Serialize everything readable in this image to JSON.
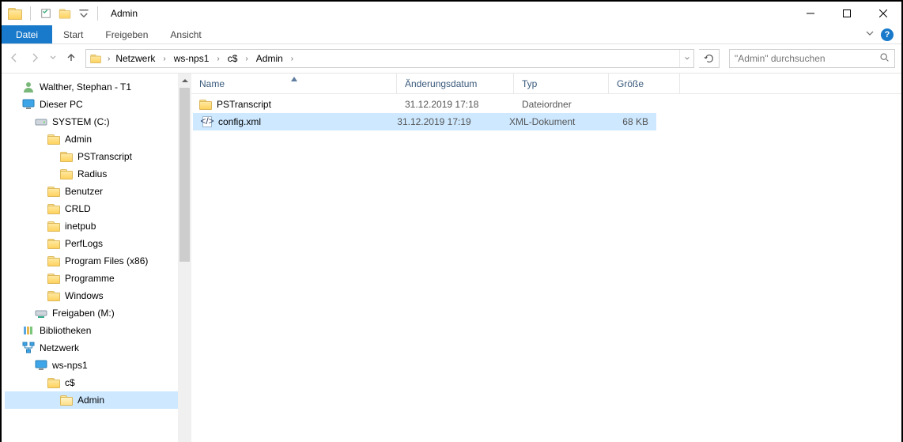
{
  "window": {
    "title": "Admin"
  },
  "ribbon": {
    "file": "Datei",
    "tabs": [
      "Start",
      "Freigeben",
      "Ansicht"
    ]
  },
  "breadcrumb": [
    "Netzwerk",
    "ws-nps1",
    "c$",
    "Admin"
  ],
  "search": {
    "placeholder": "\"Admin\" durchsuchen"
  },
  "columns": {
    "name": "Name",
    "date": "Änderungsdatum",
    "type": "Typ",
    "size": "Größe"
  },
  "files": [
    {
      "name": "PSTranscript",
      "date": "31.12.2019 17:18",
      "type": "Dateiordner",
      "size": "",
      "icon": "folder",
      "selected": false
    },
    {
      "name": "config.xml",
      "date": "31.12.2019 17:19",
      "type": "XML-Dokument",
      "size": "68 KB",
      "icon": "xml",
      "selected": true
    }
  ],
  "tree": [
    {
      "label": "Walther, Stephan - T1",
      "icon": "user",
      "indent": 0,
      "selected": false
    },
    {
      "label": "Dieser PC",
      "icon": "monitor",
      "indent": 0,
      "selected": false
    },
    {
      "label": "SYSTEM (C:)",
      "icon": "drive",
      "indent": 1,
      "selected": false
    },
    {
      "label": "Admin",
      "icon": "folder",
      "indent": 2,
      "selected": false
    },
    {
      "label": "PSTranscript",
      "icon": "folder",
      "indent": 3,
      "selected": false
    },
    {
      "label": "Radius",
      "icon": "folder",
      "indent": 3,
      "selected": false
    },
    {
      "label": "Benutzer",
      "icon": "folder",
      "indent": 2,
      "selected": false
    },
    {
      "label": "CRLD",
      "icon": "folder",
      "indent": 2,
      "selected": false
    },
    {
      "label": "inetpub",
      "icon": "folder",
      "indent": 2,
      "selected": false
    },
    {
      "label": "PerfLogs",
      "icon": "folder",
      "indent": 2,
      "selected": false
    },
    {
      "label": "Program Files (x86)",
      "icon": "folder",
      "indent": 2,
      "selected": false
    },
    {
      "label": "Programme",
      "icon": "folder",
      "indent": 2,
      "selected": false
    },
    {
      "label": "Windows",
      "icon": "folder",
      "indent": 2,
      "selected": false
    },
    {
      "label": "Freigaben (M:)",
      "icon": "share",
      "indent": 1,
      "selected": false
    },
    {
      "label": "Bibliotheken",
      "icon": "library",
      "indent": 0,
      "selected": false
    },
    {
      "label": "Netzwerk",
      "icon": "network",
      "indent": 0,
      "selected": false
    },
    {
      "label": "ws-nps1",
      "icon": "monitor",
      "indent": 1,
      "selected": false
    },
    {
      "label": "c$",
      "icon": "folder",
      "indent": 2,
      "selected": false
    },
    {
      "label": "Admin",
      "icon": "folder-open",
      "indent": 3,
      "selected": true
    }
  ]
}
